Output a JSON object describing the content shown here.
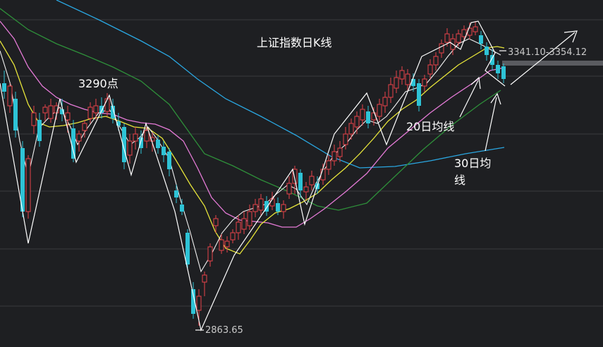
{
  "chart_data": {
    "type": "candlestick",
    "title": "上证指数日K线",
    "annotations": {
      "peak_left": "3290点",
      "low": "2863.65",
      "range_right": "3341.10-3354.12",
      "ma20": "20日均线",
      "ma30_line1": "30日均",
      "ma30_line2": "线"
    },
    "grid": true,
    "colors": {
      "background": "#1e1f22",
      "up": "#e8434a",
      "down": "#2ec3d6",
      "ma_yellow": "#e6e43a",
      "ma_pink": "#e47ad6",
      "ma_green": "#2e8f3a",
      "ma_blue": "#2aa6e0",
      "arrow": "#ffffff"
    }
  }
}
